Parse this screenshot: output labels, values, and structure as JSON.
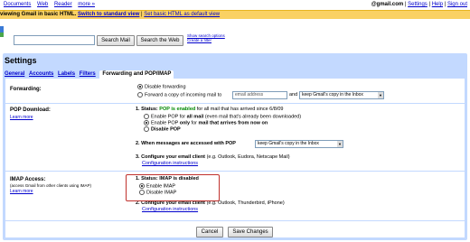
{
  "topbar": {
    "links": [
      "Documents",
      "Web",
      "Reader",
      "more »"
    ],
    "email": "@gmail.com",
    "right_links": [
      "Settings",
      "Help",
      "Sign out"
    ]
  },
  "banner": {
    "text": "viewing Gmail in basic HTML.",
    "switch_link": "Switch to standard view",
    "default_link": "Set basic HTML as default view"
  },
  "search": {
    "input_value": "",
    "search_mail": "Search Mail",
    "search_web": "Search the Web",
    "show_options": "Show search options",
    "create_filter": "Create a filter"
  },
  "settings": {
    "title": "Settings",
    "tabs": [
      "General",
      "Accounts",
      "Labels",
      "Filters",
      "Forwarding and POP/IMAP"
    ]
  },
  "forwarding": {
    "label": "Forwarding:",
    "opt_disable": "Disable forwarding",
    "opt_forward": "Forward a copy of incoming mail to",
    "email_placeholder": "email address",
    "and": "and",
    "keep_select": "keep Gmail's copy in the Inbox"
  },
  "pop": {
    "label": "POP Download:",
    "learn_more": "Learn more",
    "status_prefix": "1. Status:",
    "status_green": "POP is enabled",
    "status_suffix": "for all mail that has arrived since 6/8/09",
    "opt1_a": "Enable POP for",
    "opt1_b": "all mail",
    "opt1_c": "(even mail that's already been downloaded)",
    "opt2_a": "Enable POP",
    "opt2_b": "only",
    "opt2_c": "for",
    "opt2_d": "mail that arrives from now on",
    "opt3": "Disable POP",
    "step2": "2. When messages are accessed with POP",
    "step2_select": "keep Gmail's copy in the Inbox",
    "step3_a": "3. Configure your email client",
    "step3_b": "(e.g. Outlook, Eudora, Netscape Mail)",
    "config": "Configuration instructions"
  },
  "imap": {
    "label": "IMAP Access:",
    "sublabel": "(access Gmail from other clients using IMAP)",
    "learn_more": "Learn more",
    "status": "1. Status: IMAP is disabled",
    "opt_enable": "Enable IMAP",
    "opt_disable": "Disable IMAP",
    "step2_a": "2. Configure your email client",
    "step2_b": "(e.g. Outlook, Thunderbird, iPhone)",
    "config": "Configuration instructions"
  },
  "footer": {
    "cancel": "Cancel",
    "save": "Save Changes"
  }
}
